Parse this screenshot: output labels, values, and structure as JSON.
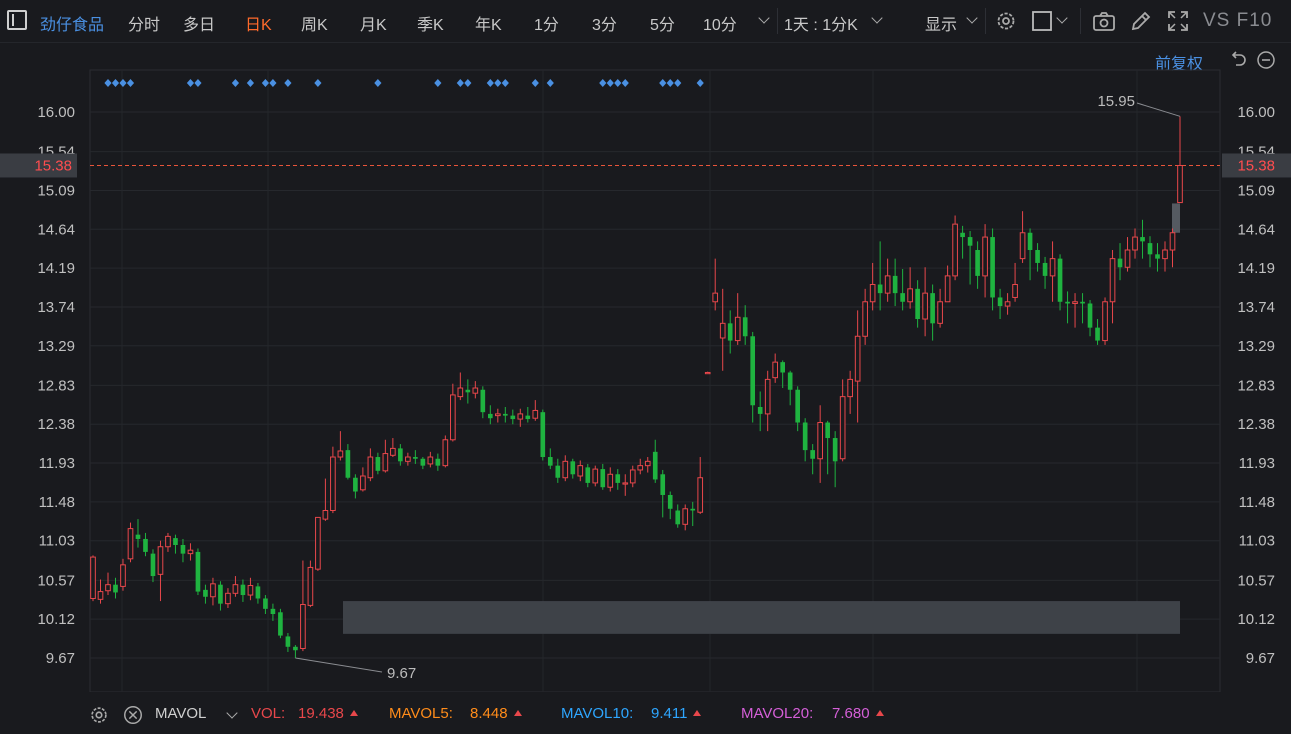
{
  "toolbar": {
    "stock_name": "劲仔食品",
    "tabs": [
      "分时",
      "多日",
      "日K",
      "周K",
      "月K",
      "季K",
      "年K",
      "1分",
      "3分",
      "5分",
      "10分"
    ],
    "active_tab": "日K",
    "period_select": "1天 : 1分K",
    "display_label": "显示",
    "vs_f10": "VS F10",
    "icons": [
      "settings-gear-icon",
      "square-shape-icon",
      "camera-icon",
      "pencil-icon",
      "fullscreen-icon"
    ]
  },
  "chart_header": {
    "adjust_label": "前复权",
    "icons": [
      "undo-icon",
      "zoom-out-icon"
    ]
  },
  "chart_data": {
    "type": "candlestick",
    "y_ticks": [
      "16.00",
      "15.54",
      "15.09",
      "14.64",
      "14.19",
      "13.74",
      "13.29",
      "12.83",
      "12.38",
      "11.93",
      "11.48",
      "11.03",
      "10.57",
      "10.12",
      "9.67"
    ],
    "ylim": [
      9.67,
      16.0
    ],
    "current_price": "15.38",
    "high_label": "15.95",
    "low_label": "9.67",
    "colors": {
      "up": "#e8474b",
      "down": "#1fb340",
      "current_line": "#e8543a",
      "marker": "#4a90e2"
    },
    "marker_indices": [
      2,
      3,
      4,
      5,
      13,
      14,
      19,
      21,
      23,
      24,
      26,
      30,
      38,
      46,
      49,
      50,
      53,
      54,
      55,
      59,
      61,
      68,
      69,
      70,
      71,
      76,
      77,
      78,
      81
    ],
    "candles": [
      [
        10.36,
        10.84,
        10.86,
        10.33
      ],
      [
        10.35,
        10.44,
        10.58,
        10.3
      ],
      [
        10.45,
        10.52,
        10.66,
        10.4
      ],
      [
        10.52,
        10.43,
        10.6,
        10.36
      ],
      [
        10.5,
        10.75,
        10.82,
        10.45
      ],
      [
        10.82,
        11.17,
        11.24,
        10.78
      ],
      [
        11.1,
        11.05,
        11.28,
        10.95
      ],
      [
        11.05,
        10.9,
        11.12,
        10.85
      ],
      [
        10.88,
        10.62,
        10.93,
        10.55
      ],
      [
        10.64,
        10.96,
        11.03,
        10.33
      ],
      [
        10.96,
        11.08,
        11.12,
        10.9
      ],
      [
        11.06,
        10.98,
        11.1,
        10.88
      ],
      [
        10.98,
        10.88,
        11.05,
        10.78
      ],
      [
        10.88,
        10.92,
        11.0,
        10.8
      ],
      [
        10.9,
        10.44,
        10.94,
        10.4
      ],
      [
        10.46,
        10.38,
        10.52,
        10.3
      ],
      [
        10.38,
        10.53,
        10.6,
        10.28
      ],
      [
        10.52,
        10.3,
        10.56,
        10.22
      ],
      [
        10.3,
        10.42,
        10.48,
        10.25
      ],
      [
        10.42,
        10.52,
        10.62,
        10.38
      ],
      [
        10.52,
        10.4,
        10.58,
        10.32
      ],
      [
        10.4,
        10.51,
        10.6,
        10.34
      ],
      [
        10.5,
        10.36,
        10.54,
        10.3
      ],
      [
        10.36,
        10.24,
        10.4,
        10.18
      ],
      [
        10.24,
        10.18,
        10.3,
        10.1
      ],
      [
        10.2,
        9.93,
        10.24,
        9.9
      ],
      [
        9.92,
        9.8,
        9.96,
        9.74
      ],
      [
        9.8,
        9.76,
        9.82,
        9.67
      ],
      [
        9.78,
        10.29,
        10.8,
        9.75
      ],
      [
        10.28,
        10.72,
        10.8,
        10.26
      ],
      [
        10.7,
        11.3,
        11.3,
        10.68
      ],
      [
        11.28,
        11.38,
        11.75,
        11.26
      ],
      [
        11.38,
        12.0,
        12.12,
        11.35
      ],
      [
        12.0,
        12.07,
        12.3,
        11.96
      ],
      [
        12.08,
        11.76,
        12.15,
        11.74
      ],
      [
        11.76,
        11.6,
        11.8,
        11.52
      ],
      [
        11.62,
        11.78,
        11.88,
        11.6
      ],
      [
        11.76,
        12.0,
        12.1,
        11.72
      ],
      [
        12.0,
        11.84,
        12.05,
        11.8
      ],
      [
        11.84,
        12.04,
        12.2,
        11.82
      ],
      [
        12.02,
        12.1,
        12.22,
        12.0
      ],
      [
        12.1,
        11.95,
        12.15,
        11.9
      ],
      [
        11.95,
        12.0,
        12.05,
        11.9
      ],
      [
        12.0,
        11.98,
        12.08,
        11.92
      ],
      [
        11.98,
        11.9,
        12.0,
        11.86
      ],
      [
        11.92,
        12.0,
        12.06,
        11.88
      ],
      [
        11.98,
        11.9,
        12.04,
        11.84
      ],
      [
        11.9,
        12.2,
        12.25,
        11.88
      ],
      [
        12.2,
        12.72,
        12.85,
        12.18
      ],
      [
        12.7,
        12.8,
        12.98,
        12.66
      ],
      [
        12.78,
        12.75,
        12.9,
        12.62
      ],
      [
        12.74,
        12.8,
        12.88,
        12.68
      ],
      [
        12.78,
        12.52,
        12.82,
        12.45
      ],
      [
        12.5,
        12.45,
        12.6,
        12.38
      ],
      [
        12.48,
        12.5,
        12.56,
        12.4
      ],
      [
        12.5,
        12.48,
        12.58,
        12.4
      ],
      [
        12.48,
        12.44,
        12.55,
        12.38
      ],
      [
        12.44,
        12.5,
        12.56,
        12.35
      ],
      [
        12.48,
        12.44,
        12.58,
        12.4
      ],
      [
        12.45,
        12.54,
        12.66,
        12.42
      ],
      [
        12.52,
        12.0,
        12.55,
        11.96
      ],
      [
        12.0,
        11.9,
        12.1,
        11.86
      ],
      [
        11.9,
        11.76,
        11.98,
        11.7
      ],
      [
        11.76,
        11.95,
        12.02,
        11.72
      ],
      [
        11.95,
        11.8,
        11.98,
        11.75
      ],
      [
        11.78,
        11.9,
        11.96,
        11.72
      ],
      [
        11.88,
        11.7,
        11.92,
        11.65
      ],
      [
        11.7,
        11.86,
        11.9,
        11.66
      ],
      [
        11.86,
        11.65,
        11.92,
        11.62
      ],
      [
        11.65,
        11.8,
        11.88,
        11.6
      ],
      [
        11.8,
        11.7,
        11.86,
        11.62
      ],
      [
        11.7,
        11.7,
        11.8,
        11.55
      ],
      [
        11.7,
        11.85,
        11.9,
        11.65
      ],
      [
        11.85,
        11.9,
        11.98,
        11.8
      ],
      [
        11.9,
        11.95,
        12.0,
        11.82
      ],
      [
        12.06,
        11.74,
        12.2,
        11.7
      ],
      [
        11.8,
        11.56,
        11.85,
        11.3
      ],
      [
        11.56,
        11.4,
        11.6,
        11.28
      ],
      [
        11.38,
        11.22,
        11.45,
        11.18
      ],
      [
        11.22,
        11.4,
        11.45,
        11.15
      ],
      [
        11.4,
        11.38,
        11.48,
        11.2
      ],
      [
        11.36,
        11.76,
        12.0,
        11.34
      ],
      [
        12.98,
        12.98,
        12.99,
        12.97
      ],
      [
        13.8,
        13.9,
        14.3,
        13.7
      ],
      [
        13.38,
        13.55,
        13.95,
        13.0
      ],
      [
        13.55,
        13.35,
        13.7,
        13.2
      ],
      [
        13.35,
        13.62,
        13.9,
        13.3
      ],
      [
        13.62,
        13.4,
        13.76,
        13.3
      ],
      [
        13.4,
        12.6,
        13.45,
        12.4
      ],
      [
        12.58,
        12.5,
        12.76,
        12.3
      ],
      [
        12.5,
        12.9,
        13.0,
        12.3
      ],
      [
        12.92,
        13.1,
        13.2,
        12.86
      ],
      [
        13.1,
        12.98,
        13.12,
        12.8
      ],
      [
        12.98,
        12.78,
        13.0,
        12.6
      ],
      [
        12.78,
        12.4,
        12.82,
        12.3
      ],
      [
        12.4,
        12.08,
        12.45,
        11.95
      ],
      [
        12.08,
        11.98,
        12.15,
        11.8
      ],
      [
        11.98,
        12.4,
        12.6,
        11.7
      ],
      [
        12.4,
        12.22,
        12.42,
        11.8
      ],
      [
        12.22,
        11.95,
        12.3,
        11.65
      ],
      [
        11.98,
        12.7,
        12.9,
        11.95
      ],
      [
        12.7,
        12.9,
        13.0,
        12.5
      ],
      [
        12.88,
        13.4,
        13.7,
        12.4
      ],
      [
        13.4,
        13.8,
        13.95,
        13.3
      ],
      [
        13.8,
        14.0,
        14.25,
        13.7
      ],
      [
        14.0,
        13.9,
        14.5,
        13.7
      ],
      [
        13.9,
        14.1,
        14.3,
        13.8
      ],
      [
        14.1,
        13.9,
        14.3,
        13.75
      ],
      [
        13.9,
        13.8,
        14.18,
        13.7
      ],
      [
        13.8,
        13.95,
        14.2,
        13.72
      ],
      [
        13.95,
        13.6,
        14.05,
        13.5
      ],
      [
        13.6,
        13.9,
        14.2,
        13.4
      ],
      [
        13.9,
        13.55,
        14.0,
        13.35
      ],
      [
        13.55,
        13.8,
        13.95,
        13.5
      ],
      [
        13.8,
        14.1,
        14.22,
        13.8
      ],
      [
        14.1,
        14.7,
        14.8,
        14.05
      ],
      [
        14.6,
        14.55,
        14.68,
        14.3
      ],
      [
        14.55,
        14.45,
        14.62,
        14.0
      ],
      [
        14.4,
        14.1,
        14.5,
        13.95
      ],
      [
        14.1,
        14.55,
        14.7,
        13.85
      ],
      [
        14.55,
        13.85,
        14.65,
        13.7
      ],
      [
        13.85,
        13.75,
        13.95,
        13.6
      ],
      [
        13.75,
        13.8,
        13.9,
        13.65
      ],
      [
        13.85,
        14.0,
        14.25,
        13.8
      ],
      [
        14.3,
        14.6,
        14.85,
        14.25
      ],
      [
        14.6,
        14.4,
        14.65,
        14.05
      ],
      [
        14.4,
        14.25,
        14.48,
        14.15
      ],
      [
        14.25,
        14.1,
        14.32,
        13.95
      ],
      [
        14.1,
        14.3,
        14.5,
        13.8
      ],
      [
        14.3,
        13.8,
        14.35,
        13.7
      ],
      [
        13.8,
        13.78,
        13.92,
        13.55
      ],
      [
        13.78,
        13.8,
        13.9,
        13.5
      ],
      [
        13.8,
        13.78,
        13.9,
        13.55
      ],
      [
        13.78,
        13.5,
        13.82,
        13.4
      ],
      [
        13.5,
        13.35,
        13.6,
        13.3
      ],
      [
        13.35,
        13.8,
        13.85,
        13.3
      ],
      [
        13.8,
        14.3,
        14.4,
        13.55
      ],
      [
        14.3,
        14.2,
        14.48,
        14.05
      ],
      [
        14.2,
        14.4,
        14.55,
        14.15
      ],
      [
        14.4,
        14.55,
        14.65,
        14.3
      ],
      [
        14.55,
        14.5,
        14.75,
        14.3
      ],
      [
        14.48,
        14.35,
        14.56,
        14.2
      ],
      [
        14.35,
        14.3,
        14.48,
        14.15
      ],
      [
        14.3,
        14.4,
        14.5,
        14.15
      ],
      [
        14.4,
        14.6,
        14.65,
        14.2
      ],
      [
        14.95,
        15.38,
        15.95,
        14.95
      ]
    ],
    "price_band": [
      9.95,
      10.33
    ]
  },
  "volume_bar": {
    "indicator": "MAVOL",
    "vol_label": "VOL:",
    "vol_value": "19.438",
    "mavol5_label": "MAVOL5:",
    "mavol5_value": "8.448",
    "mavol10_label": "MAVOL10:",
    "mavol10_value": "9.411",
    "mavol20_label": "MAVOL20:",
    "mavol20_value": "7.680",
    "colors": {
      "vol": "#e8474b",
      "mavol5": "#ff8c1a",
      "mavol10": "#2ea6ff",
      "mavol20": "#d55fd8"
    }
  }
}
